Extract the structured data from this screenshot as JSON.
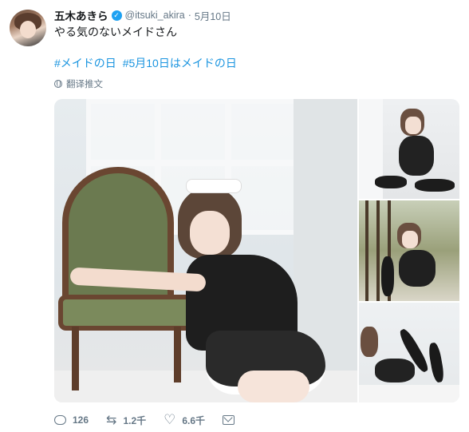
{
  "author": {
    "display_name": "五木あきら",
    "handle": "@itsuki_akira",
    "date": "5月10日",
    "verified": true
  },
  "tweet": {
    "text": "やる気のないメイドさん",
    "hashtags": [
      "#メイドの日",
      "#5月10日はメイドの日"
    ],
    "translate_label": "翻译推文"
  },
  "media": {
    "photo_count": 4
  },
  "actions": {
    "reply_count": "126",
    "retweet_count": "1.2千",
    "like_count": "6.6千"
  },
  "colors": {
    "link": "#1b95e0",
    "verified": "#1da1f2",
    "muted": "#657786"
  }
}
